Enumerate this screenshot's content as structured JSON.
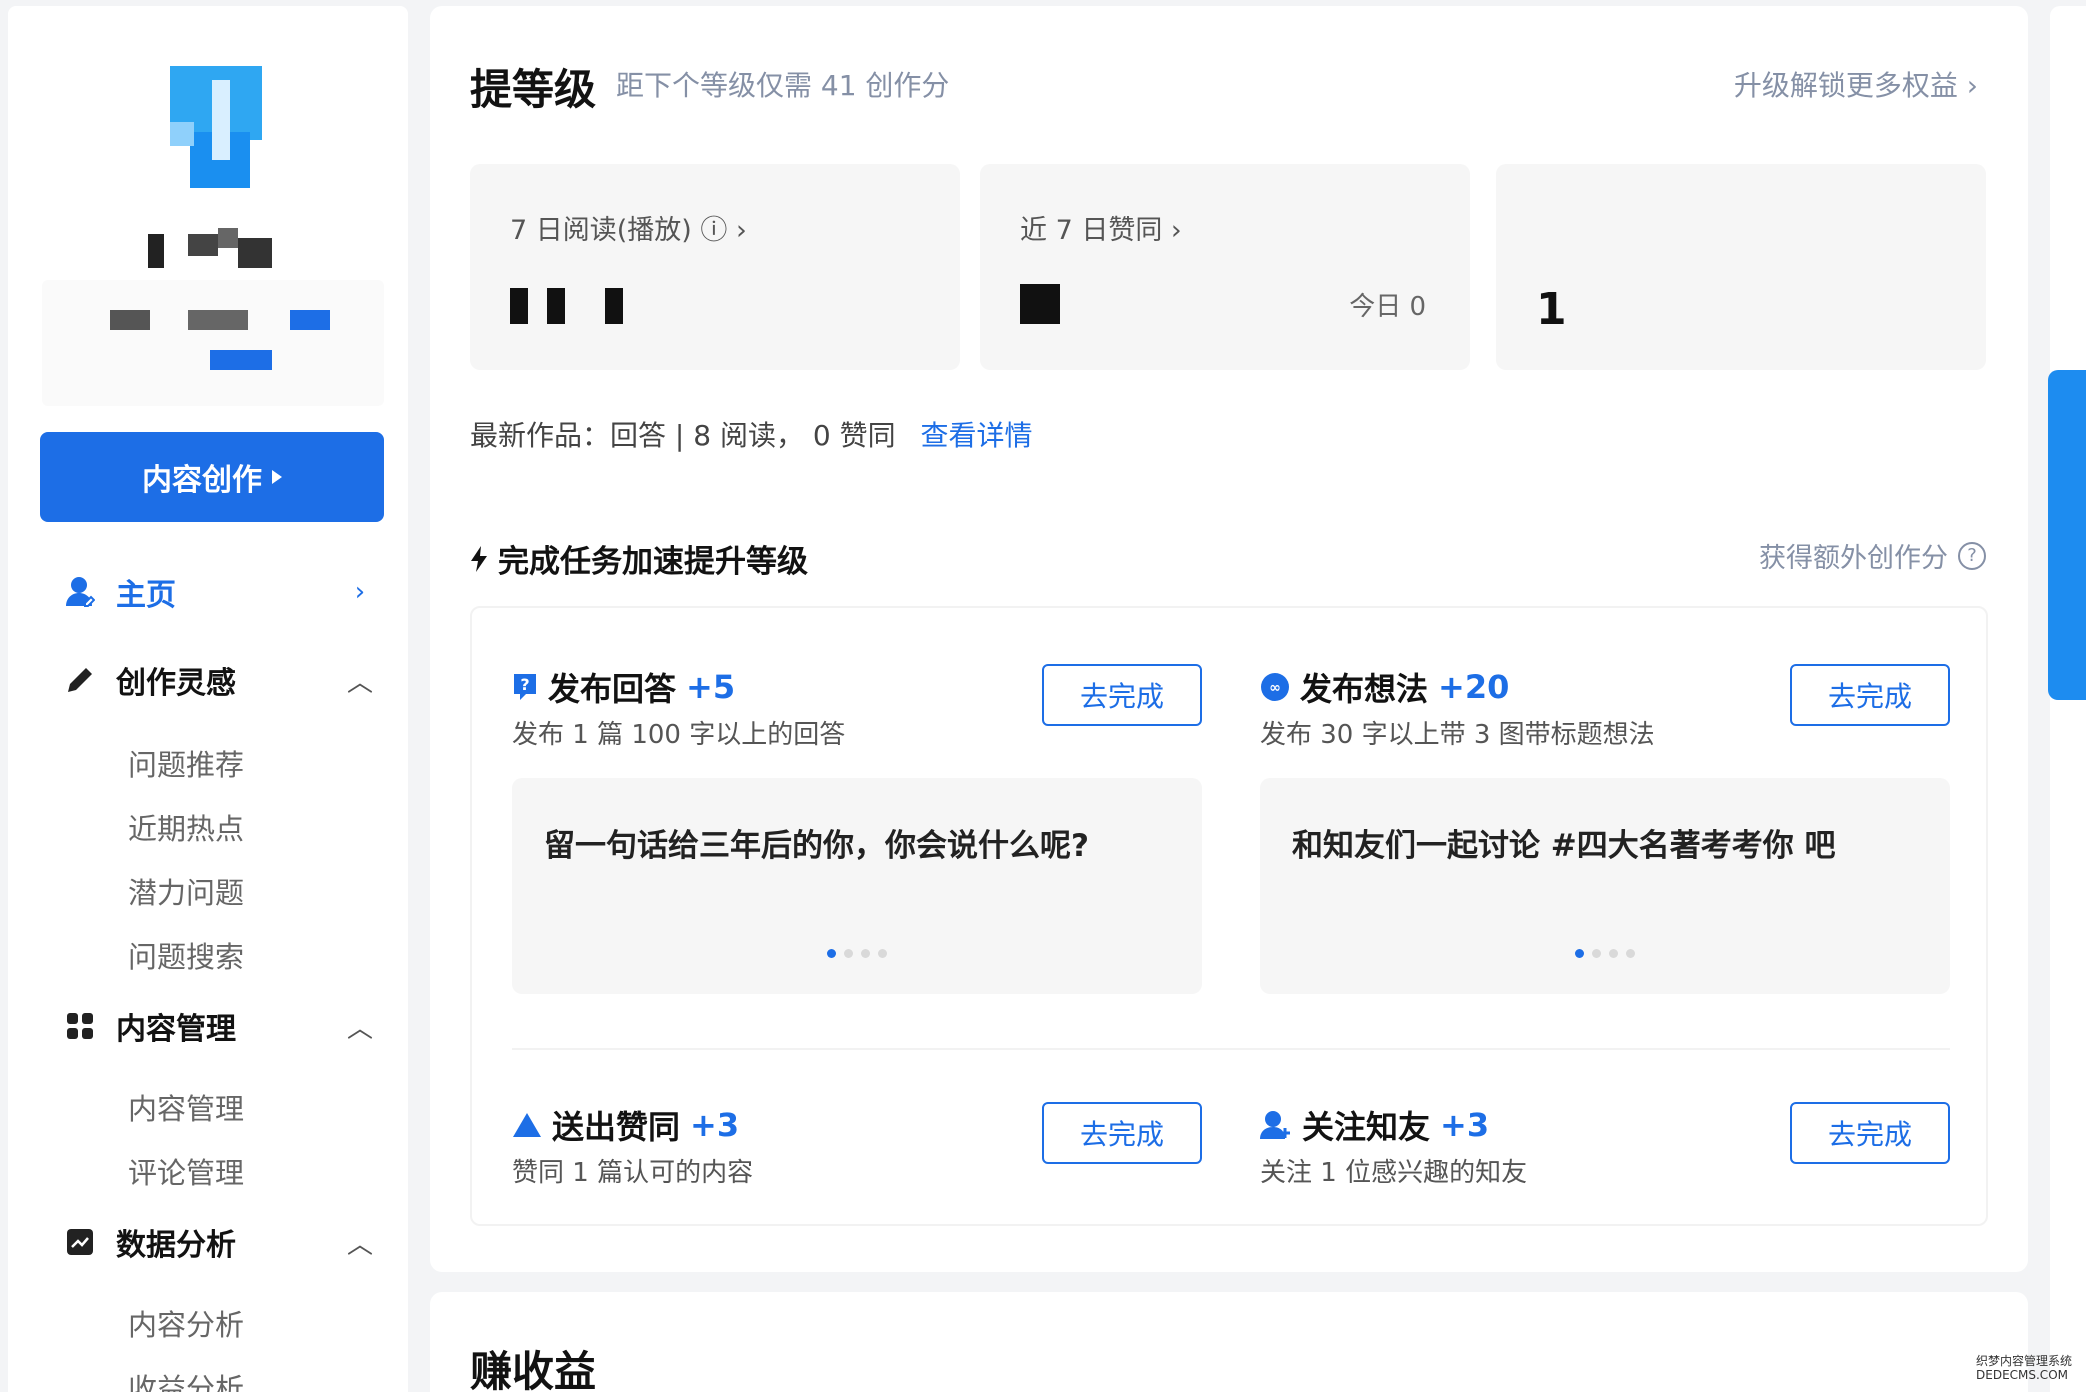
{
  "sidebar": {
    "create_button": "内容创作",
    "nav": [
      {
        "label": "主页",
        "active": true
      },
      {
        "label": "创作灵感"
      },
      {
        "label": "内容管理"
      },
      {
        "label": "数据分析"
      }
    ],
    "inspiration_items": [
      "问题推荐",
      "近期热点",
      "潜力问题",
      "问题搜索"
    ],
    "content_items": [
      "内容管理",
      "评论管理"
    ],
    "analysis_items": [
      "内容分析",
      "收益分析"
    ]
  },
  "level": {
    "title": "提等级",
    "subtitle": "距下个等级仅需 41 创作分",
    "upgrade_link": "升级解锁更多权益 ›"
  },
  "stats": [
    {
      "label": "7 日阅读(播放) ⓘ ›",
      "value": "",
      "today": ""
    },
    {
      "label": "近 7 日赞同 ›",
      "value": "",
      "today": "今日 0"
    },
    {
      "label": "",
      "value": "1",
      "today": ""
    }
  ],
  "latest": {
    "text": "最新作品：回答 | 8 阅读， 0 赞同",
    "link": "查看详情"
  },
  "tasks": {
    "heading": "完成任务加速提升等级",
    "extra": "获得额外创作分",
    "items": [
      {
        "title": "发布回答",
        "points": "+5",
        "desc": "发布 1 篇 100 字以上的回答",
        "button": "去完成",
        "prompt": "留一句话给三年后的你，你会说什么呢?"
      },
      {
        "title": "发布想法",
        "points": "+20",
        "desc": "发布 30 字以上带 3 图带标题想法",
        "button": "去完成",
        "prompt": "和知友们一起讨论 #四大名著考考你 吧"
      },
      {
        "title": "送出赞同",
        "points": "+3",
        "desc": "赞同 1 篇认可的内容",
        "button": "去完成"
      },
      {
        "title": "关注知友",
        "points": "+3",
        "desc": "关注 1 位感兴趣的知友",
        "button": "去完成"
      }
    ]
  },
  "earn": {
    "title": "赚收益"
  },
  "watermark": [
    "织梦内容管理系统",
    "DEDECMS.COM"
  ],
  "colors": {
    "accent": "#1d6ee6",
    "muted": "#8590a6"
  }
}
